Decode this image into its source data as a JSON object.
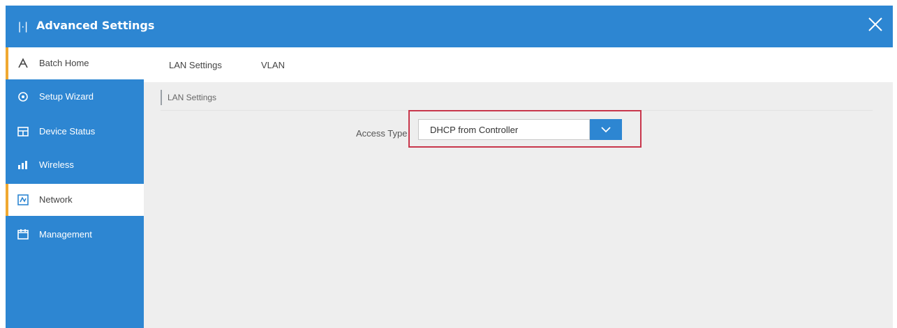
{
  "window": {
    "title": "Advanced Settings",
    "close_icon": "close-icon",
    "accent_color": "#2d86d2",
    "active_marker_color": "#f0a830",
    "highlight_color": "#c8364b"
  },
  "sidebar": {
    "items": [
      {
        "label": "Batch Home",
        "icon": "home-icon",
        "active": true
      },
      {
        "label": "Setup Wizard",
        "icon": "wizard-icon",
        "active": false
      },
      {
        "label": "Device Status",
        "icon": "status-icon",
        "active": false
      },
      {
        "label": "Wireless",
        "icon": "wireless-icon",
        "active": false
      },
      {
        "label": "Network",
        "icon": "network-icon",
        "active": true
      },
      {
        "label": "Management",
        "icon": "management-icon",
        "active": false
      }
    ]
  },
  "tabs": [
    {
      "label": "LAN Settings"
    },
    {
      "label": "VLAN"
    }
  ],
  "section": {
    "title": "LAN Settings"
  },
  "form": {
    "access_label": "Access Type",
    "access_value": "DHCP from Controller"
  }
}
